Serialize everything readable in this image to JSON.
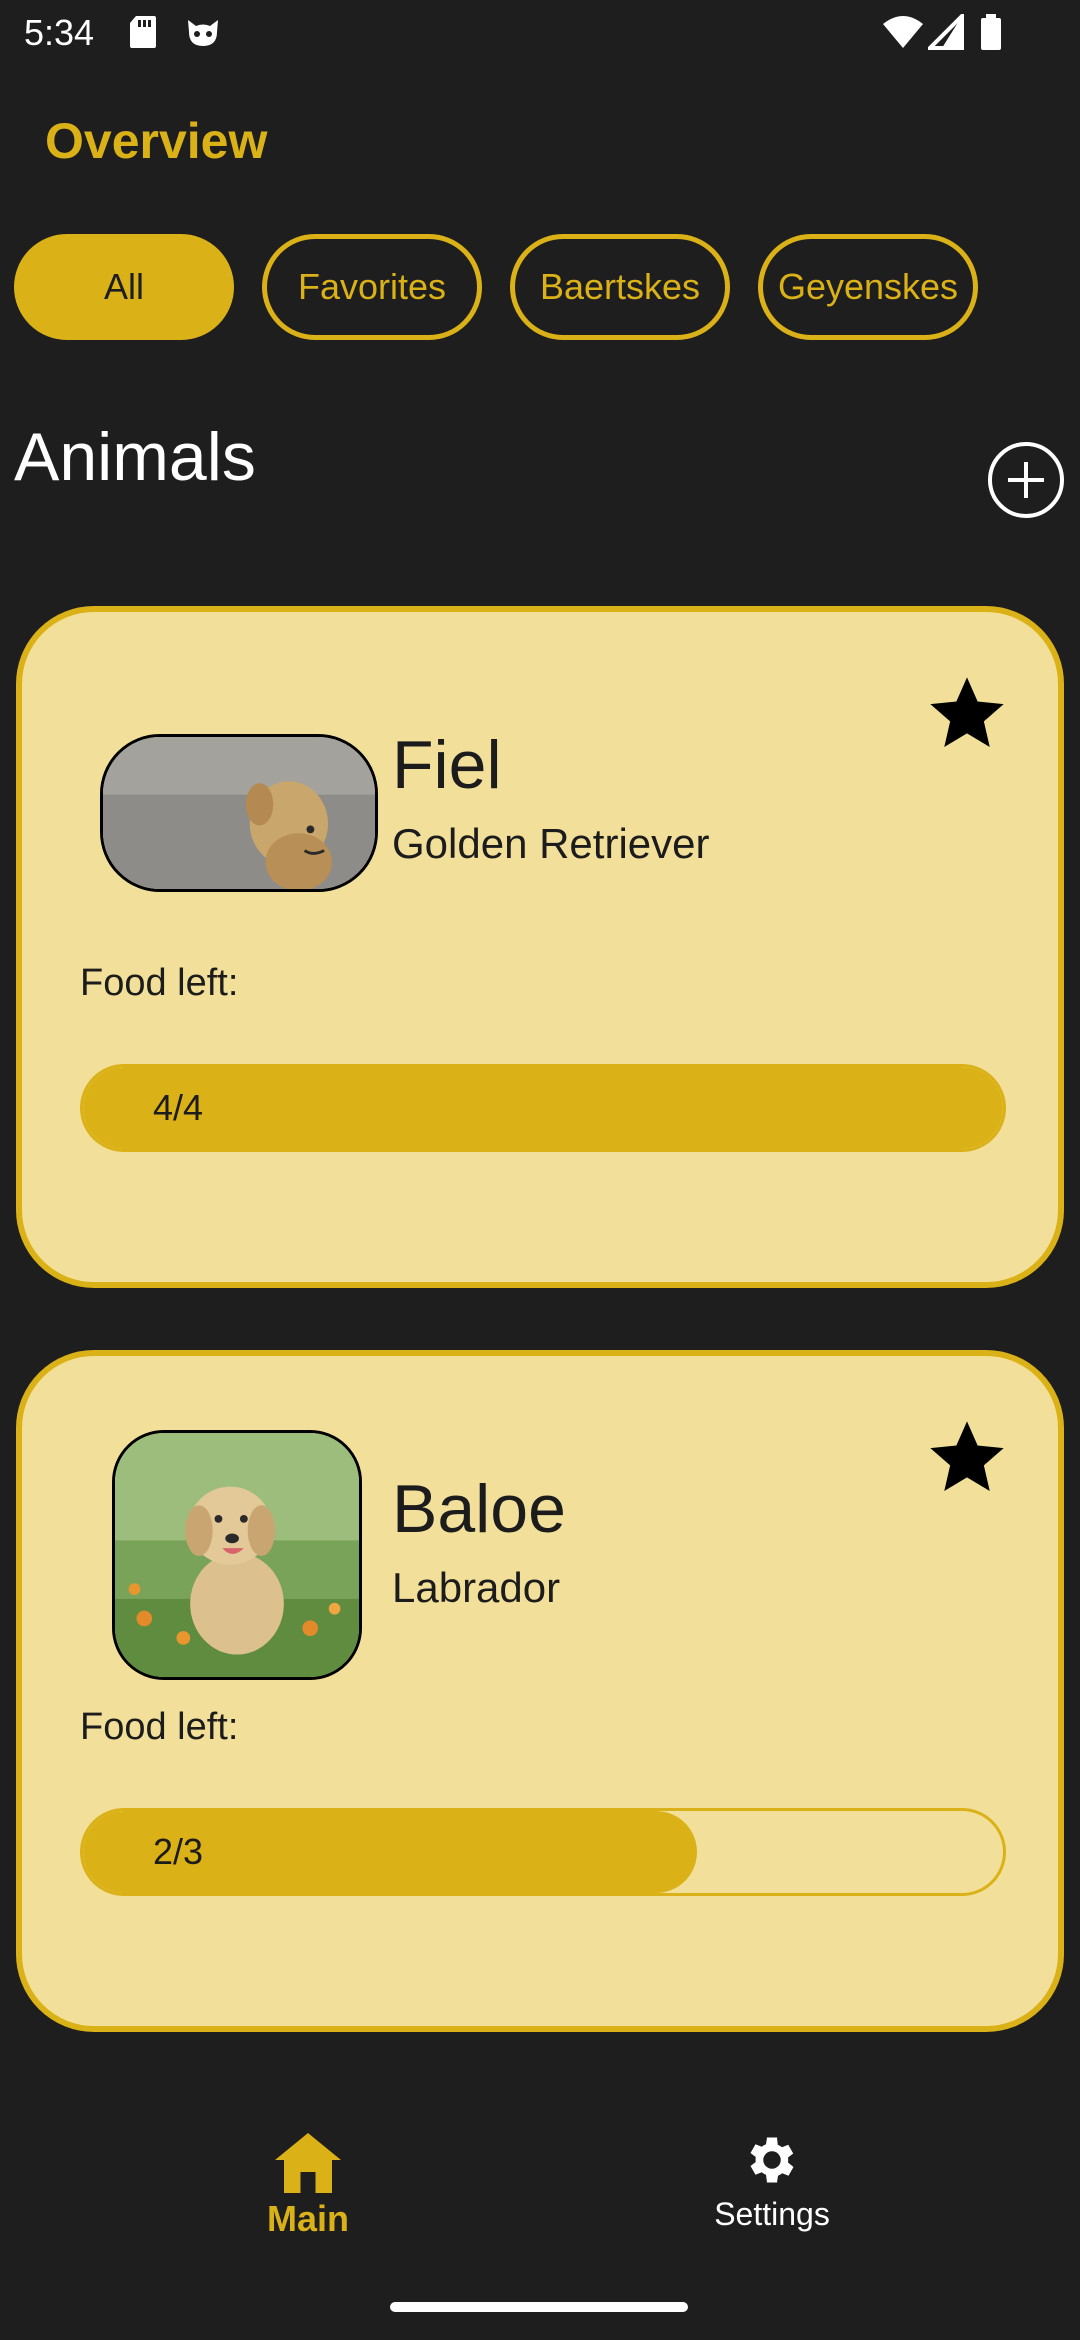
{
  "status_bar": {
    "time": "5:34",
    "icons": [
      "sd-card-icon",
      "cat-face-icon",
      "wifi-icon",
      "signal-icon",
      "battery-icon"
    ]
  },
  "header": {
    "title": "Overview"
  },
  "filters": [
    {
      "label": "All",
      "selected": true
    },
    {
      "label": "Favorites",
      "selected": false
    },
    {
      "label": "Baertskes",
      "selected": false
    },
    {
      "label": "Geyenskes",
      "selected": false
    }
  ],
  "section": {
    "title": "Animals",
    "add_icon": "plus-circle-icon"
  },
  "animals": [
    {
      "name": "Fiel",
      "breed": "Golden Retriever",
      "favorite": true,
      "food_label": "Food left:",
      "food_text": "4/4",
      "food_fraction": 1.0
    },
    {
      "name": "Baloe",
      "breed": "Labrador",
      "favorite": true,
      "food_label": "Food left:",
      "food_text": "2/3",
      "food_fraction": 0.667
    }
  ],
  "bottom_nav": {
    "items": [
      {
        "label": "Main",
        "icon": "home-icon",
        "active": true
      },
      {
        "label": "Settings",
        "icon": "gear-icon",
        "active": false
      }
    ]
  },
  "colors": {
    "accent": "#dbb118",
    "card_bg": "#f2e09a",
    "background": "#1e1e1e"
  }
}
